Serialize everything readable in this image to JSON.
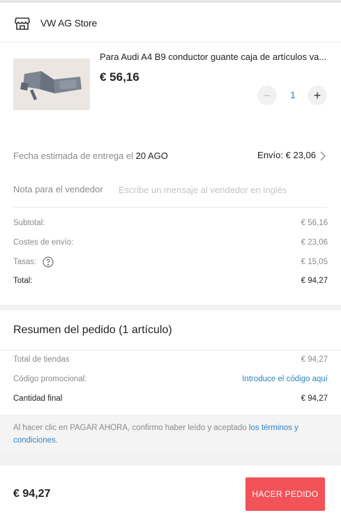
{
  "store": {
    "icon": "storefront-icon",
    "name": "VW AG Store"
  },
  "product": {
    "image": "glove-box-part-image",
    "title": "Para Audi A4 B9 conductor guante caja de artículos va...",
    "price": "€ 56,16",
    "quantity": "1",
    "minus_label": "−",
    "plus_label": "+"
  },
  "delivery": {
    "label": "Fecha estimada de entrega el ",
    "date": "20 AGO",
    "shipping": "Envío: € 23,06"
  },
  "note": {
    "label": "Nota para el vendedor",
    "placeholder": "Escribe un mensaje al vendedor en inglés"
  },
  "costs": {
    "subtotal_label": "Subtotal:",
    "subtotal": "€ 56,16",
    "shipping_label": "Costes de envío:",
    "shipping": "€ 23,06",
    "taxes_label": "Tasas:",
    "taxes": "€ 15,05",
    "total_label": "Total:",
    "total": "€ 94,27"
  },
  "summary": {
    "title": "Resumen del pedido (1 artículo)",
    "stores_total_label": "Total de tiendas",
    "stores_total": "€ 94,27",
    "promo_label": "Código promocional:",
    "promo_link": "Introduce el código aquí",
    "final_label": "Cantidad final",
    "final": "€ 94,27"
  },
  "legal": {
    "text": "Al hacer clic en PAGAR AHORA, confirmo haber leído y aceptado ",
    "link": "los términos y condiciones",
    "end": "."
  },
  "checkout": {
    "price": "€ 94,27",
    "button": "HACER PEDIDO"
  },
  "colors": {
    "accent_blue": "#2d86c8",
    "button_red": "#f15358"
  }
}
